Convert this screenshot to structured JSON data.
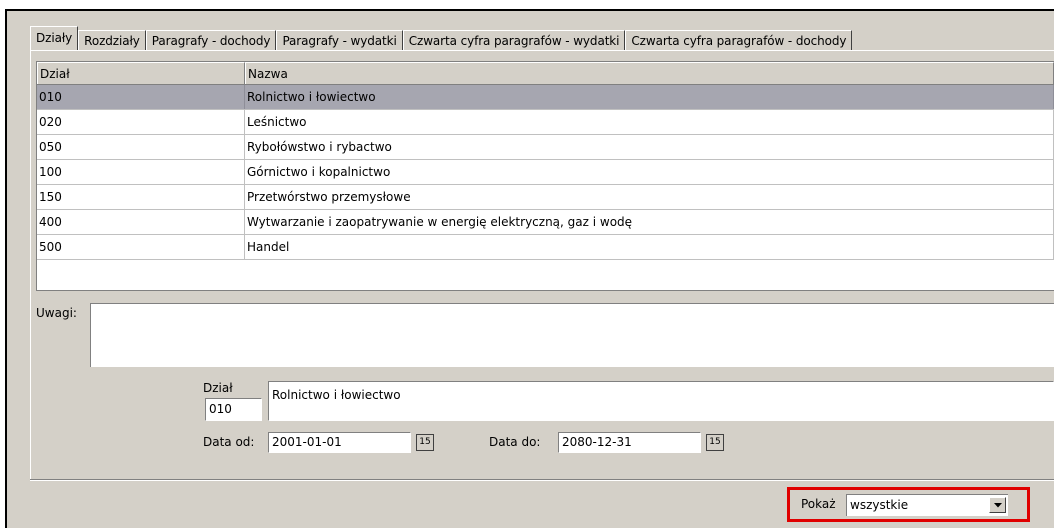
{
  "tabs": [
    {
      "label": "Działy"
    },
    {
      "label": "Rozdziały"
    },
    {
      "label": "Paragrafy - dochody"
    },
    {
      "label": "Paragrafy - wydatki"
    },
    {
      "label": "Czwarta cyfra paragrafów - wydatki"
    },
    {
      "label": "Czwarta cyfra paragrafów - dochody"
    }
  ],
  "grid": {
    "columns": [
      "Dział",
      "Nazwa"
    ],
    "rows": [
      {
        "dzial": "010",
        "nazwa": "Rolnictwo i łowiectwo"
      },
      {
        "dzial": "020",
        "nazwa": "Leśnictwo"
      },
      {
        "dzial": "050",
        "nazwa": "Rybołówstwo i rybactwo"
      },
      {
        "dzial": "100",
        "nazwa": "Górnictwo i kopalnictwo"
      },
      {
        "dzial": "150",
        "nazwa": "Przetwórstwo przemysłowe"
      },
      {
        "dzial": "400",
        "nazwa": "Wytwarzanie i zaopatrywanie w energię elektryczną, gaz i wodę"
      },
      {
        "dzial": "500",
        "nazwa": "Handel"
      }
    ],
    "selected_index": 0
  },
  "form": {
    "uwagi_label": "Uwagi:",
    "uwagi_value": "",
    "dzial_label": "Dział",
    "dzial_value": "010",
    "nazwa_value": "Rolnictwo i łowiectwo",
    "data_od_label": "Data od:",
    "data_od_value": "2001-01-01",
    "data_do_label": "Data do:",
    "data_do_value": "2080-12-31",
    "calendar_glyph": "15"
  },
  "footer": {
    "pokaz_label": "Pokaż",
    "pokaz_value": "wszystkie"
  },
  "colors": {
    "selected_row": "#a6a6b0",
    "highlight": "#e00000",
    "face": "#d4d0c8"
  }
}
